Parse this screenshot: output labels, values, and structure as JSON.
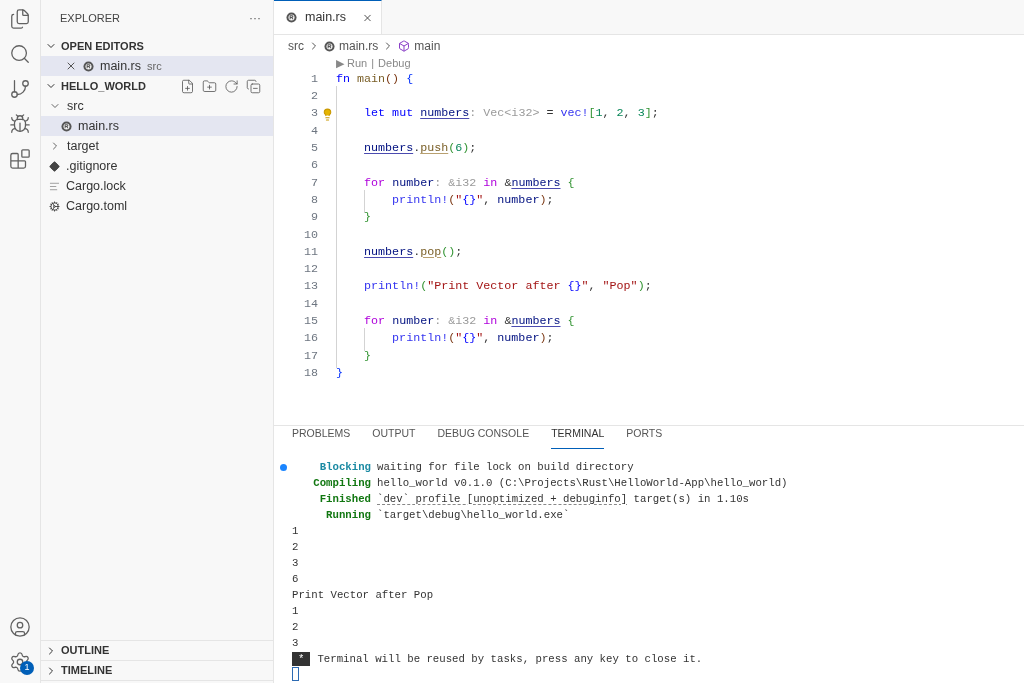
{
  "activity_bar": {
    "manage_badge": "1"
  },
  "sidebar": {
    "title": "EXPLORER",
    "more": "···",
    "open_editors": {
      "title": "OPEN EDITORS",
      "expanded": true,
      "items": [
        {
          "name": "main.rs",
          "description": "src",
          "kind": "rust",
          "selected": true
        }
      ]
    },
    "folder": {
      "title": "HELLO_WORLD",
      "expanded": true,
      "tree": [
        {
          "name": "src",
          "kind": "folder",
          "expanded": true,
          "selected": false,
          "children": [
            {
              "name": "main.rs",
              "kind": "rust",
              "selected": true
            }
          ]
        },
        {
          "name": "target",
          "kind": "folder",
          "expanded": false,
          "selected": false
        },
        {
          "name": ".gitignore",
          "kind": "git",
          "selected": false
        },
        {
          "name": "Cargo.lock",
          "kind": "text",
          "selected": false
        },
        {
          "name": "Cargo.toml",
          "kind": "config",
          "selected": false
        }
      ]
    },
    "bottom_sections": [
      {
        "title": "OUTLINE",
        "expanded": false
      },
      {
        "title": "TIMELINE",
        "expanded": false
      }
    ]
  },
  "editor": {
    "tabs": [
      {
        "label": "main.rs",
        "kind": "rust",
        "selected": true
      }
    ],
    "breadcrumb": [
      {
        "label": "src",
        "kind": "folder"
      },
      {
        "label": "main.rs",
        "kind": "rust"
      },
      {
        "label": "main",
        "kind": "module"
      }
    ],
    "code_lens": {
      "run": "▶ Run",
      "separator": "|",
      "debug": "Debug"
    },
    "lines": [
      {
        "number": "1",
        "tokens": [
          {
            "text": "fn ",
            "kind": "kw"
          },
          {
            "text": "main",
            "kind": "fn"
          },
          {
            "text": "() ",
            "kind": "b3"
          },
          {
            "text": "{",
            "kind": "b1"
          }
        ]
      },
      {
        "number": "2"
      },
      {
        "number": "3",
        "lightbulb": true,
        "tokens": [
          {
            "text": "    let mut ",
            "kind": "kw"
          },
          {
            "text": "numbers",
            "kind": "var",
            "underline": true
          },
          {
            "text": ": Vec<i32>",
            "kind": "hint"
          },
          {
            "text": " = ",
            "kind": "plain"
          },
          {
            "text": "vec!",
            "kind": "macro"
          },
          {
            "text": "[",
            "kind": "b2"
          },
          {
            "text": "1",
            "kind": "num"
          },
          {
            "text": ", ",
            "kind": "plain"
          },
          {
            "text": "2",
            "kind": "num"
          },
          {
            "text": ", ",
            "kind": "plain"
          },
          {
            "text": "3",
            "kind": "num"
          },
          {
            "text": "]",
            "kind": "b2"
          },
          {
            "text": ";",
            "kind": "plain"
          }
        ]
      },
      {
        "number": "4"
      },
      {
        "number": "5",
        "tokens": [
          {
            "text": "    numbers",
            "kind": "var",
            "underline": true
          },
          {
            "text": ".",
            "kind": "plain"
          },
          {
            "text": "push",
            "kind": "fn",
            "underline": true
          },
          {
            "text": "(",
            "kind": "b2"
          },
          {
            "text": "6",
            "kind": "num"
          },
          {
            "text": ")",
            "kind": "b2"
          },
          {
            "text": ";",
            "kind": "plain"
          }
        ]
      },
      {
        "number": "6"
      },
      {
        "number": "7",
        "tokens": [
          {
            "text": "    for",
            "kind": "ctrl"
          },
          {
            "text": " number",
            "kind": "var"
          },
          {
            "text": ": &i32",
            "kind": "hint"
          },
          {
            "text": " in",
            "kind": "ctrl"
          },
          {
            "text": " &",
            "kind": "plain"
          },
          {
            "text": "numbers",
            "kind": "var",
            "underline": true
          },
          {
            "text": " {",
            "kind": "b2"
          }
        ]
      },
      {
        "number": "8",
        "tokens": [
          {
            "text": "        println!",
            "kind": "macro"
          },
          {
            "text": "(",
            "kind": "b3"
          },
          {
            "text": "\"",
            "kind": "str"
          },
          {
            "text": "{}",
            "kind": "fmt"
          },
          {
            "text": "\"",
            "kind": "str"
          },
          {
            "text": ", ",
            "kind": "plain"
          },
          {
            "text": "number",
            "kind": "var"
          },
          {
            "text": ")",
            "kind": "b3"
          },
          {
            "text": ";",
            "kind": "plain"
          }
        ]
      },
      {
        "number": "9",
        "tokens": [
          {
            "text": "    }",
            "kind": "b2"
          }
        ]
      },
      {
        "number": "10"
      },
      {
        "number": "11",
        "tokens": [
          {
            "text": "    numbers",
            "kind": "var",
            "underline": true
          },
          {
            "text": ".",
            "kind": "plain"
          },
          {
            "text": "pop",
            "kind": "fn",
            "underline": true
          },
          {
            "text": "()",
            "kind": "b2"
          },
          {
            "text": ";",
            "kind": "plain"
          }
        ]
      },
      {
        "number": "12"
      },
      {
        "number": "13",
        "tokens": [
          {
            "text": "    println!",
            "kind": "macro"
          },
          {
            "text": "(",
            "kind": "b2"
          },
          {
            "text": "\"Print Vector after ",
            "kind": "str"
          },
          {
            "text": "{}",
            "kind": "fmt"
          },
          {
            "text": "\"",
            "kind": "str"
          },
          {
            "text": ", ",
            "kind": "plain"
          },
          {
            "text": "\"Pop\"",
            "kind": "str"
          },
          {
            "text": ")",
            "kind": "b2"
          },
          {
            "text": ";",
            "kind": "plain"
          }
        ]
      },
      {
        "number": "14"
      },
      {
        "number": "15",
        "tokens": [
          {
            "text": "    for",
            "kind": "ctrl"
          },
          {
            "text": " number",
            "kind": "var"
          },
          {
            "text": ": &i32",
            "kind": "hint"
          },
          {
            "text": " in",
            "kind": "ctrl"
          },
          {
            "text": " &",
            "kind": "plain"
          },
          {
            "text": "numbers",
            "kind": "var",
            "underline": true
          },
          {
            "text": " {",
            "kind": "b2"
          }
        ]
      },
      {
        "number": "16",
        "tokens": [
          {
            "text": "        println!",
            "kind": "macro"
          },
          {
            "text": "(",
            "kind": "b3"
          },
          {
            "text": "\"",
            "kind": "str"
          },
          {
            "text": "{}",
            "kind": "fmt"
          },
          {
            "text": "\"",
            "kind": "str"
          },
          {
            "text": ", ",
            "kind": "plain"
          },
          {
            "text": "number",
            "kind": "var"
          },
          {
            "text": ")",
            "kind": "b3"
          },
          {
            "text": ";",
            "kind": "plain"
          }
        ]
      },
      {
        "number": "17",
        "tokens": [
          {
            "text": "    }",
            "kind": "b2"
          }
        ]
      },
      {
        "number": "18",
        "tokens": [
          {
            "text": "}",
            "kind": "b1"
          }
        ]
      }
    ]
  },
  "panel": {
    "tabs": [
      {
        "label": "PROBLEMS",
        "selected": false
      },
      {
        "label": "OUTPUT",
        "selected": false
      },
      {
        "label": "DEBUG CONSOLE",
        "selected": false
      },
      {
        "label": "TERMINAL",
        "selected": true
      },
      {
        "label": "PORTS",
        "selected": false
      }
    ],
    "terminal": [
      {
        "kind": "cargo",
        "color": "#1b8aa3",
        "marker": true,
        "label": "Blocking",
        "parts": [
          {
            "text": "waiting for file lock on build directory",
            "link": false
          }
        ]
      },
      {
        "kind": "cargo",
        "color": "#117711",
        "marker": false,
        "label": "Compiling",
        "parts": [
          {
            "text": "hello_world v0.1.0 (C:\\Projects\\Rust\\HelloWorld-App\\hello_world)",
            "link": false
          }
        ]
      },
      {
        "kind": "cargo",
        "color": "#117711",
        "marker": false,
        "label": "Finished",
        "parts": [
          {
            "text": "`dev` profile [unoptimized + debuginfo]",
            "link": true
          },
          {
            "text": " target(s) in 1.10s",
            "link": false
          }
        ]
      },
      {
        "kind": "cargo",
        "color": "#117711",
        "marker": false,
        "label": "Running",
        "parts": [
          {
            "text": "`target\\debug\\hello_world.exe`",
            "link": false
          }
        ]
      },
      {
        "kind": "output",
        "text": "1"
      },
      {
        "kind": "output",
        "text": "2"
      },
      {
        "kind": "output",
        "text": "3"
      },
      {
        "kind": "output",
        "text": "6"
      },
      {
        "kind": "output",
        "text": "Print Vector after Pop"
      },
      {
        "kind": "output",
        "text": "1"
      },
      {
        "kind": "output",
        "text": "2"
      },
      {
        "kind": "output",
        "text": "3"
      },
      {
        "kind": "notice",
        "badge": "*",
        "text": "Terminal will be reused by tasks, press any key to close it."
      },
      {
        "kind": "cursor"
      }
    ]
  }
}
